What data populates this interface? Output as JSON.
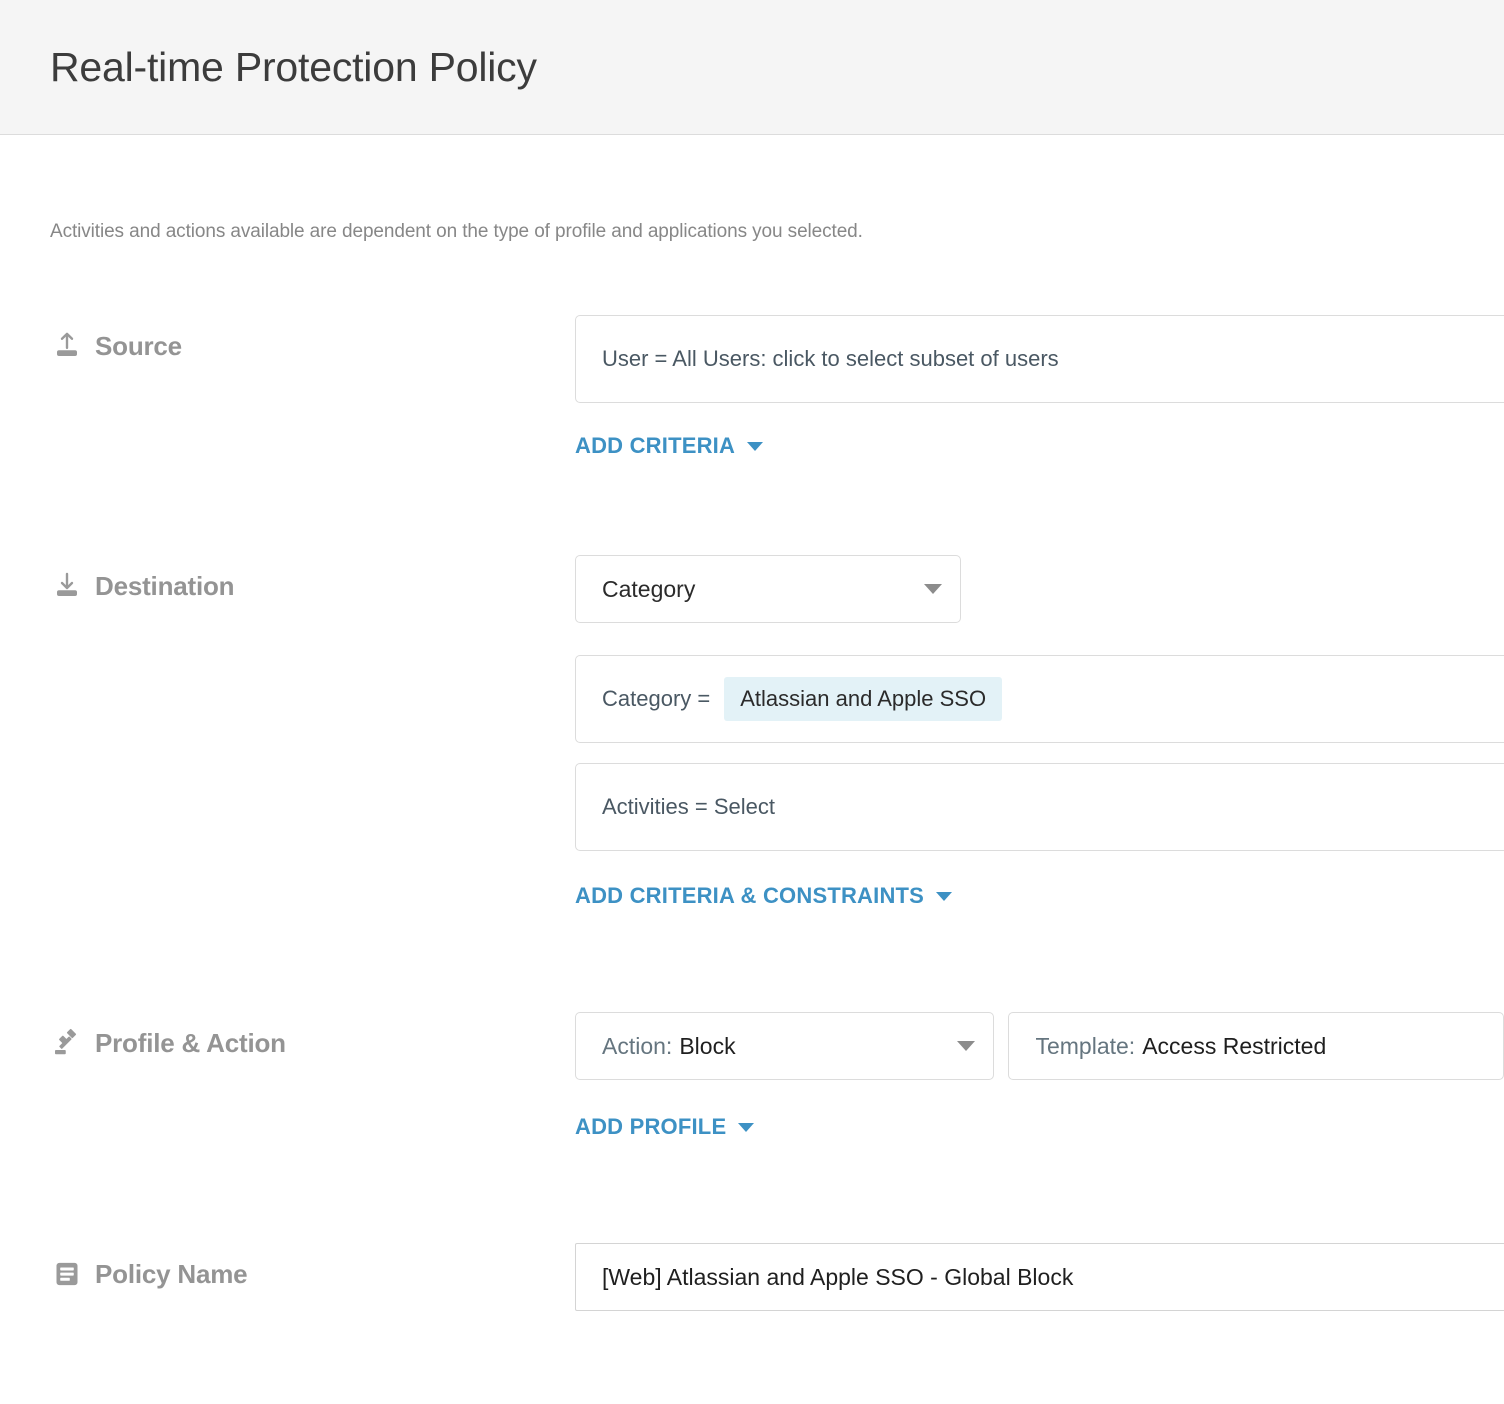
{
  "header": {
    "title": "Real-time Protection Policy"
  },
  "intro": {
    "text": "Activities and actions available are dependent on the type of profile and applications you selected."
  },
  "colors": {
    "accent_link": "#3d91c4",
    "chip_background": "#e3f2f7",
    "header_background": "#f5f5f5",
    "label_text": "#949494",
    "border": "#dcdcdc"
  },
  "sections": {
    "source": {
      "label": "Source",
      "icon": "upload-icon",
      "criteria_value": "User = All Users: click to select subset of users",
      "add_link": "ADD CRITERIA"
    },
    "destination": {
      "label": "Destination",
      "icon": "download-icon",
      "type_select": "Category",
      "criteria_prefix": "Category =",
      "criteria_chip": "Atlassian and Apple SSO",
      "activities_value": "Activities = Select",
      "add_link": "ADD CRITERIA & CONSTRAINTS"
    },
    "profile_action": {
      "label": "Profile & Action",
      "icon": "gavel-icon",
      "action_key": "Action:",
      "action_value": "Block",
      "template_key": "Template:",
      "template_value": "Access Restricted",
      "add_link": "ADD PROFILE"
    },
    "policy_name": {
      "label": "Policy Name",
      "icon": "document-list-icon",
      "value": "[Web] Atlassian and Apple SSO - Global Block"
    }
  }
}
